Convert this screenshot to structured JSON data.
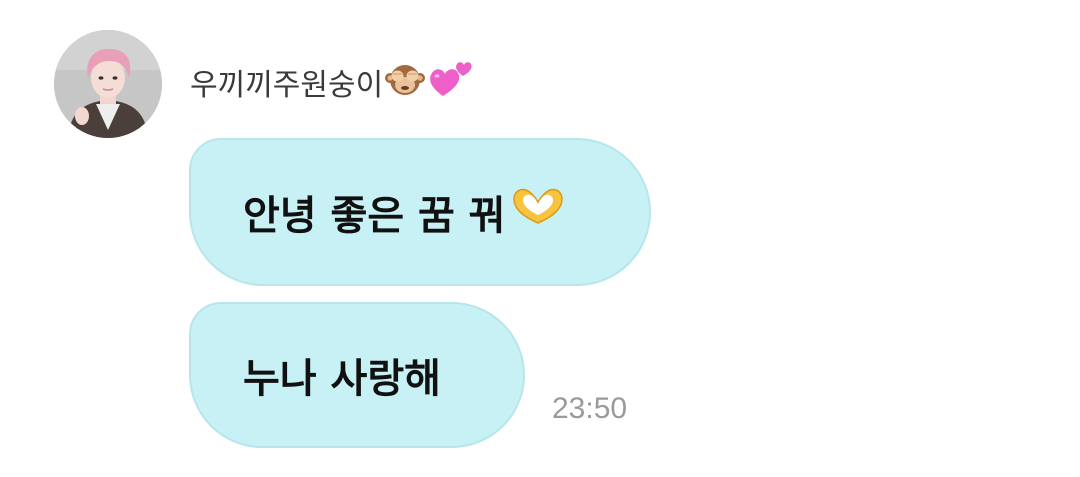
{
  "chat": {
    "sender_name": "우끼끼주원숭이",
    "sender_emojis": [
      "see-no-evil-monkey-icon",
      "two-hearts-icon"
    ],
    "messages": [
      {
        "text": "안녕 좋은 꿈 꿔",
        "emoji": "heart-hands-icon"
      },
      {
        "text": "누나 사랑해"
      }
    ],
    "timestamp": "23:50"
  },
  "colors": {
    "bubble_fill": "#c8f1f5",
    "bubble_border": "#b6e6ec",
    "timestamp": "#9a9a9a",
    "sender_name": "#3a3a3a"
  }
}
